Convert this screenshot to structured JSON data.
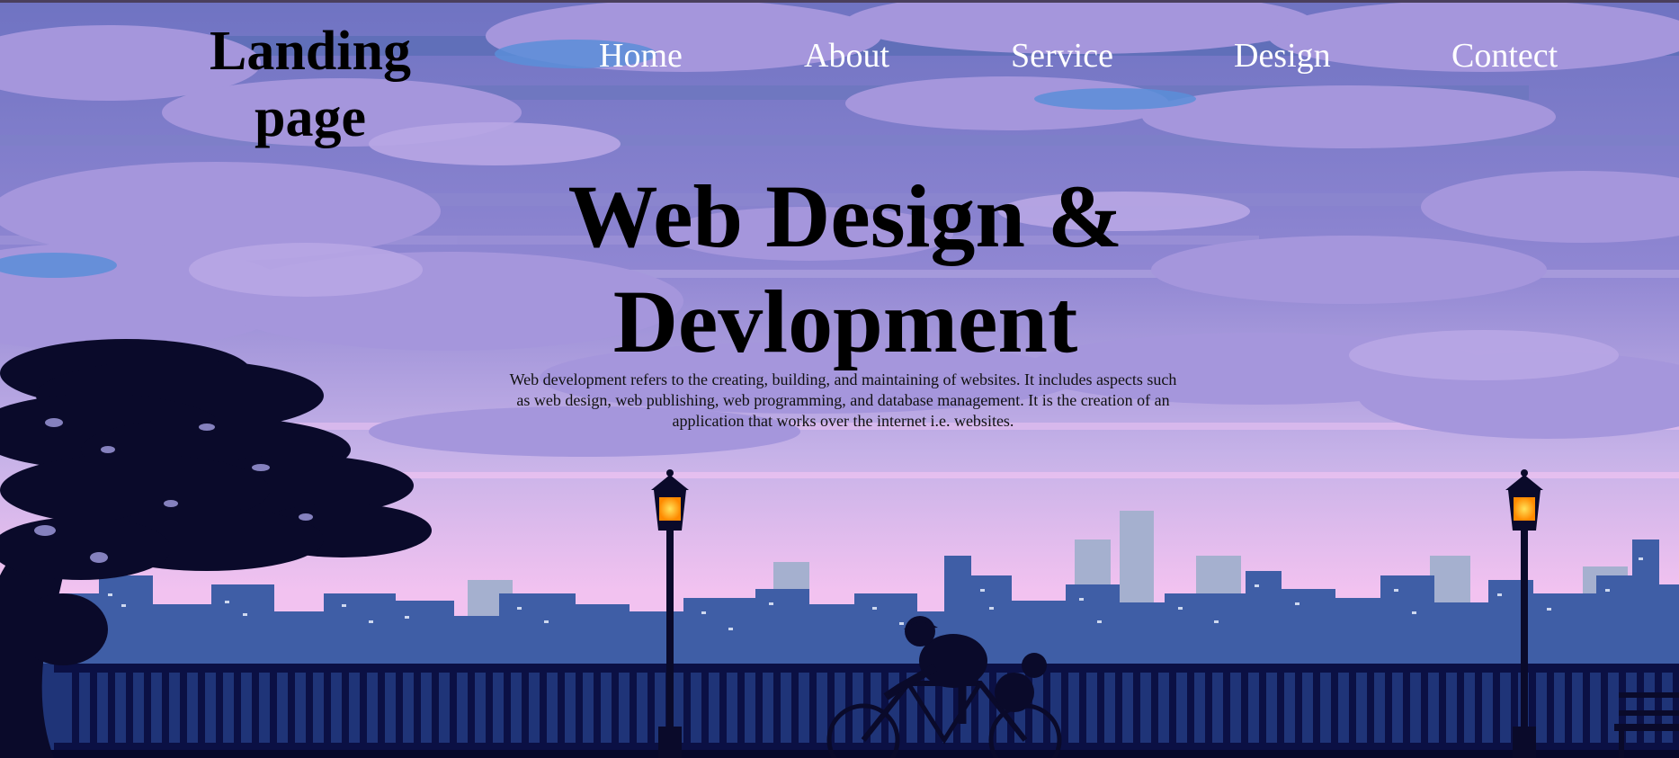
{
  "header": {
    "logo_text": "Landing page",
    "nav": [
      {
        "label": "Home"
      },
      {
        "label": "About"
      },
      {
        "label": "Service"
      },
      {
        "label": "Design"
      },
      {
        "label": "Contect"
      }
    ]
  },
  "hero": {
    "title": "Web Design & Devlopment",
    "description": "Web development refers to the creating, building, and maintaining of websites. It includes aspects such as web design, web publishing, web programming, and database management. It is the creation of an application that works over the internet i.e. websites."
  },
  "colors": {
    "sky_top": "#7d78c8",
    "sky_pink": "#f2bff0",
    "cloud_lavender": "#a596dc",
    "city_blue": "#3d5aa0",
    "railing_navy": "#1f3478",
    "silhouette": "#0a0a2a",
    "lamp_glow": "#ffb21a",
    "nav_text": "#ffffff"
  },
  "icons": [
    "street-lamp-icon",
    "cyclist-icon",
    "tree-icon",
    "bench-icon"
  ]
}
